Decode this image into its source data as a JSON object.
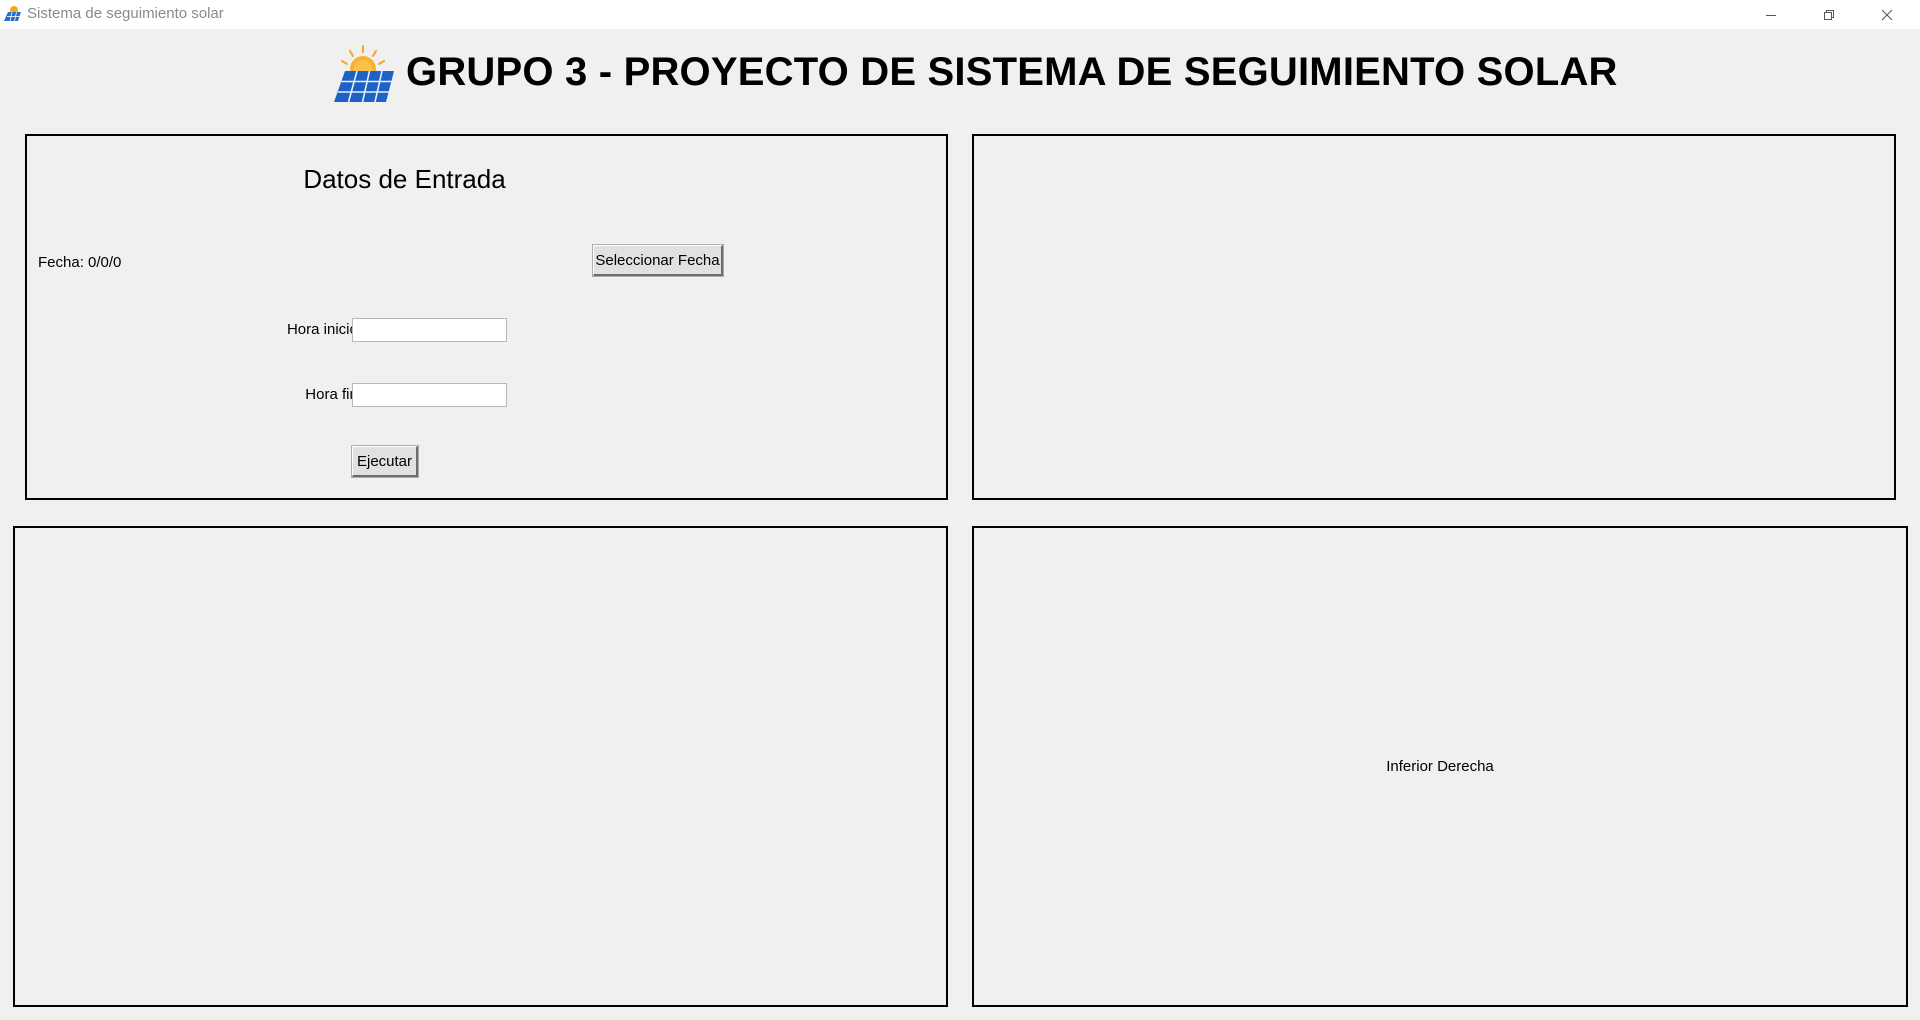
{
  "window": {
    "title": "Sistema de seguimiento solar",
    "controls": [
      "minimize-icon",
      "restore-icon",
      "close-icon"
    ]
  },
  "header": {
    "title": "GRUPO 3 - PROYECTO DE SISTEMA DE SEGUIMIENTO SOLAR",
    "logo_icon": "solar-panel-sun-icon"
  },
  "input_panel": {
    "title": "Datos de Entrada",
    "fecha_label": "Fecha: 0/0/0",
    "select_date_button": "Seleccionar Fecha",
    "hora_inicio_label": "Hora inicio:",
    "hora_inicio_value": "",
    "hora_fin_label": "Hora fin:",
    "hora_fin_value": "",
    "execute_button": "Ejecutar"
  },
  "bottom_right_panel": {
    "label": "Inferior Derecha"
  },
  "colors": {
    "background": "#f0f0f0",
    "border": "#000000",
    "panel_blue": "#1f6fd1",
    "sun_orange": "#f6a623"
  }
}
